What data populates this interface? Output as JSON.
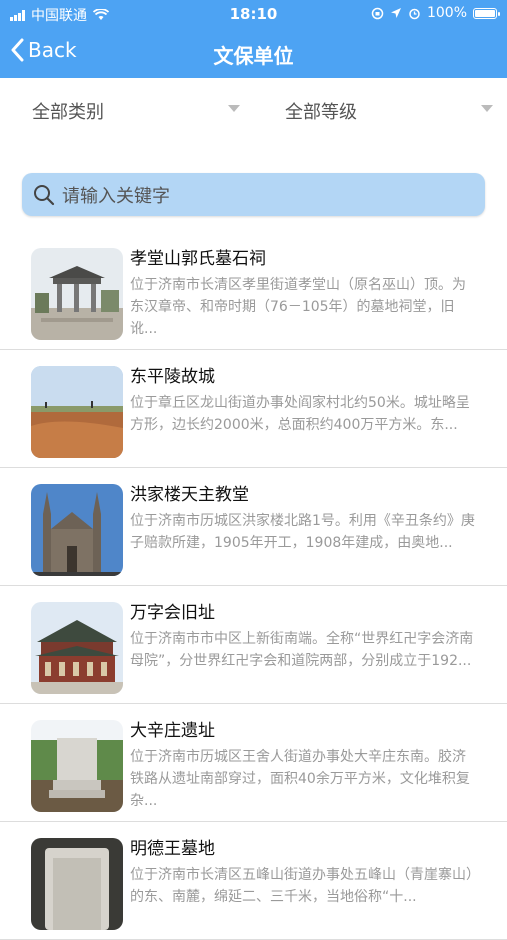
{
  "status_bar": {
    "carrier": "中国联通",
    "time": "18:10",
    "battery": "100%"
  },
  "nav": {
    "back_label": "Back",
    "title": "文保单位"
  },
  "filters": {
    "category": "全部类别",
    "level": "全部等级"
  },
  "search": {
    "placeholder": "请输入关键字"
  },
  "items": [
    {
      "title": "孝堂山郭氏墓石祠",
      "desc": "位于济南市长清区孝里街道孝堂山（原名巫山）顶。为东汉章帝、和帝时期（76－105年）的墓地祠堂，旧讹..."
    },
    {
      "title": "东平陵故城",
      "desc": "位于章丘区龙山街道办事处阎家村北约50米。城址略呈方形，边长约2000米，总面积约400万平方米。东..."
    },
    {
      "title": "洪家楼天主教堂",
      "desc": "位于济南市历城区洪家楼北路1号。利用《辛丑条约》庚子赔款所建，1905年开工，1908年建成，由奥地..."
    },
    {
      "title": "万字会旧址",
      "desc": "位于济南市市中区上新街南端。全称“世界红卍字会济南母院”，分世界红卍字会和道院两部，分别成立于192..."
    },
    {
      "title": "大辛庄遗址",
      "desc": "位于济南市历城区王舍人街道办事处大辛庄东南。胶济铁路从遗址南部穿过，面积40余万平方米，文化堆积复杂..."
    },
    {
      "title": "明德王墓地",
      "desc": "位于济南市长清区五峰山街道办事处五峰山（青崖寨山）的东、南麓，绵延二、三千米，当地俗称“十..."
    }
  ]
}
